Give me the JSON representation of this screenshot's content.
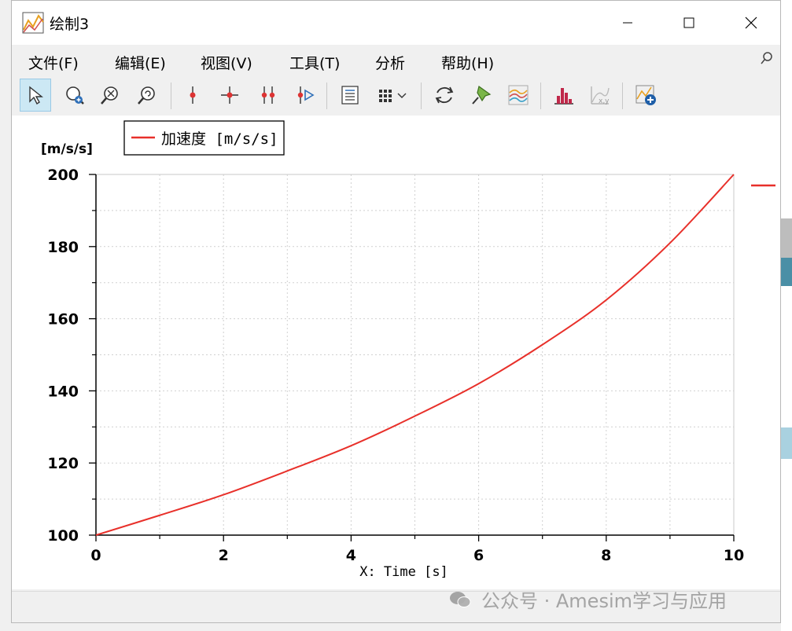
{
  "window": {
    "title": "绘制3",
    "minimize_label": "—",
    "maximize_label": "☐",
    "close_label": "✕"
  },
  "menu": {
    "items": [
      "文件(F)",
      "编辑(E)",
      "视图(V)",
      "工具(T)",
      "分析",
      "帮助(H)"
    ]
  },
  "toolbar": {
    "buttons": [
      {
        "icon": "select-arrow-icon",
        "active": true
      },
      {
        "icon": "zoom-in-icon",
        "active": false
      },
      {
        "icon": "zoom-fit-icon",
        "active": false
      },
      {
        "icon": "zoom-out-icon",
        "active": false
      },
      {
        "icon": "single-marker-icon",
        "active": false
      },
      {
        "icon": "crosshair-marker-icon",
        "active": false
      },
      {
        "icon": "double-marker-icon",
        "active": false
      },
      {
        "icon": "marker-play-icon",
        "active": false
      },
      {
        "icon": "legend-list-icon",
        "active": false
      },
      {
        "icon": "grid-layout-icon",
        "active": false
      },
      {
        "icon": "refresh-icon",
        "active": false
      },
      {
        "icon": "pin-icon",
        "active": false
      },
      {
        "icon": "curves-icon",
        "active": false
      },
      {
        "icon": "histogram-icon",
        "active": false
      },
      {
        "icon": "xy-plot-icon",
        "active": false
      },
      {
        "icon": "add-plot-icon",
        "active": false
      }
    ]
  },
  "chart_data": {
    "type": "line",
    "title": "",
    "xlabel": "X: Time [s]",
    "ylabel": "[m/s/s]",
    "xlim": [
      0,
      10
    ],
    "ylim": [
      100,
      200
    ],
    "xticks": [
      0,
      2,
      4,
      6,
      8,
      10
    ],
    "yticks": [
      100,
      120,
      140,
      160,
      180,
      200
    ],
    "grid": true,
    "legend_position": "top-left",
    "series": [
      {
        "name": "加速度 [m/s/s]",
        "color": "#e8302a",
        "x": [
          0,
          1,
          2,
          3,
          4,
          5,
          6,
          7,
          8,
          9,
          10
        ],
        "y": [
          100,
          105.5,
          111.2,
          117.8,
          124.8,
          133.0,
          142.0,
          152.8,
          165.2,
          181.0,
          200.0
        ]
      }
    ]
  },
  "watermark": {
    "text": "公众号 · Amesim学习与应用"
  },
  "colors": {
    "series_red": "#e8302a",
    "active_button": "#cce8f4",
    "teal_strip": "#4a8fa6"
  }
}
